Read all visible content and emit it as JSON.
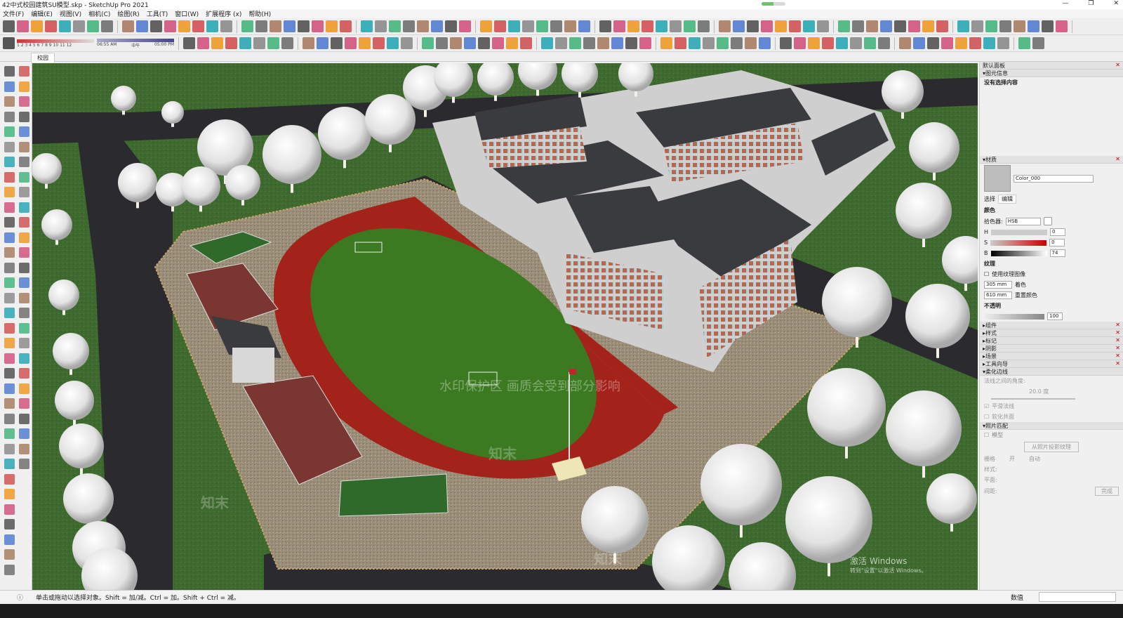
{
  "window": {
    "title": "42中式校园建筑SU模型.skp - SketchUp Pro 2021",
    "progress": 0.5
  },
  "menu": [
    "文件(F)",
    "编辑(E)",
    "视图(V)",
    "相机(C)",
    "绘图(R)",
    "工具(T)",
    "窗口(W)",
    "扩展程序 (x)",
    "帮助(H)"
  ],
  "shadow": {
    "months": "1 2 3 4 5 6 7 8 9 10 11 12",
    "time_start": "06:55 AM",
    "time_mid": "中午",
    "time_end": "05:00 PM"
  },
  "scene_tab": "校园",
  "viewport_watermark": {
    "banner": "水印保护区 画质会受到部分影响",
    "logo": "知末",
    "activate": "激活 Windows",
    "activate_sub": "转到\"设置\"以激活 Windows。"
  },
  "panel": {
    "title": "默认面板",
    "entity_info": {
      "header": "图元信息",
      "empty": "没有选择内容"
    },
    "materials": {
      "header": "材质",
      "name": "Color_000",
      "tabs": [
        "选择",
        "编辑"
      ],
      "color_label": "颜色",
      "picker_label": "拾色器:",
      "picker_value": "HSB",
      "h_label": "H",
      "h_value": "0",
      "s_label": "S",
      "s_value": "0",
      "b_label": "B",
      "b_value": "74",
      "texture_label": "纹理",
      "use_texture": "使用纹理图像",
      "tex_w": "305 mm",
      "tex_h": "610 mm",
      "colorize": "着色",
      "reset_color": "重置颜色",
      "opacity_label": "不透明",
      "opacity_value": "100"
    },
    "collapsed": [
      "组件",
      "样式",
      "标记",
      "阴影",
      "场景",
      "工具向导"
    ],
    "soften": {
      "header": "柔化边线",
      "angle_label": "法线之间的角度:",
      "angle_value": "20.0 度",
      "smooth": "平滑法线",
      "soften_coplanar": "软化共面"
    },
    "photo_match": {
      "header": "照片匹配",
      "model": "模型",
      "grab_button": "从照片投影纹理",
      "grid": "栅格",
      "on": "开",
      "auto": "自动",
      "style": "样式:",
      "plane": "平面:",
      "spacing": "间距:",
      "done": "完成"
    }
  },
  "status": {
    "text": "单击或拖动以选择对象。Shift = 加/减。Ctrl = 加。Shift + Ctrl = 减。",
    "measure_label": "数值"
  },
  "colors": {
    "grass": "#3f6a2f",
    "track": "#a3231a",
    "field": "#3c7a22",
    "road": "#2b2a2e",
    "roof": "#3a3b3f",
    "wall": "#d8d8d8",
    "court": "#7a3631"
  }
}
